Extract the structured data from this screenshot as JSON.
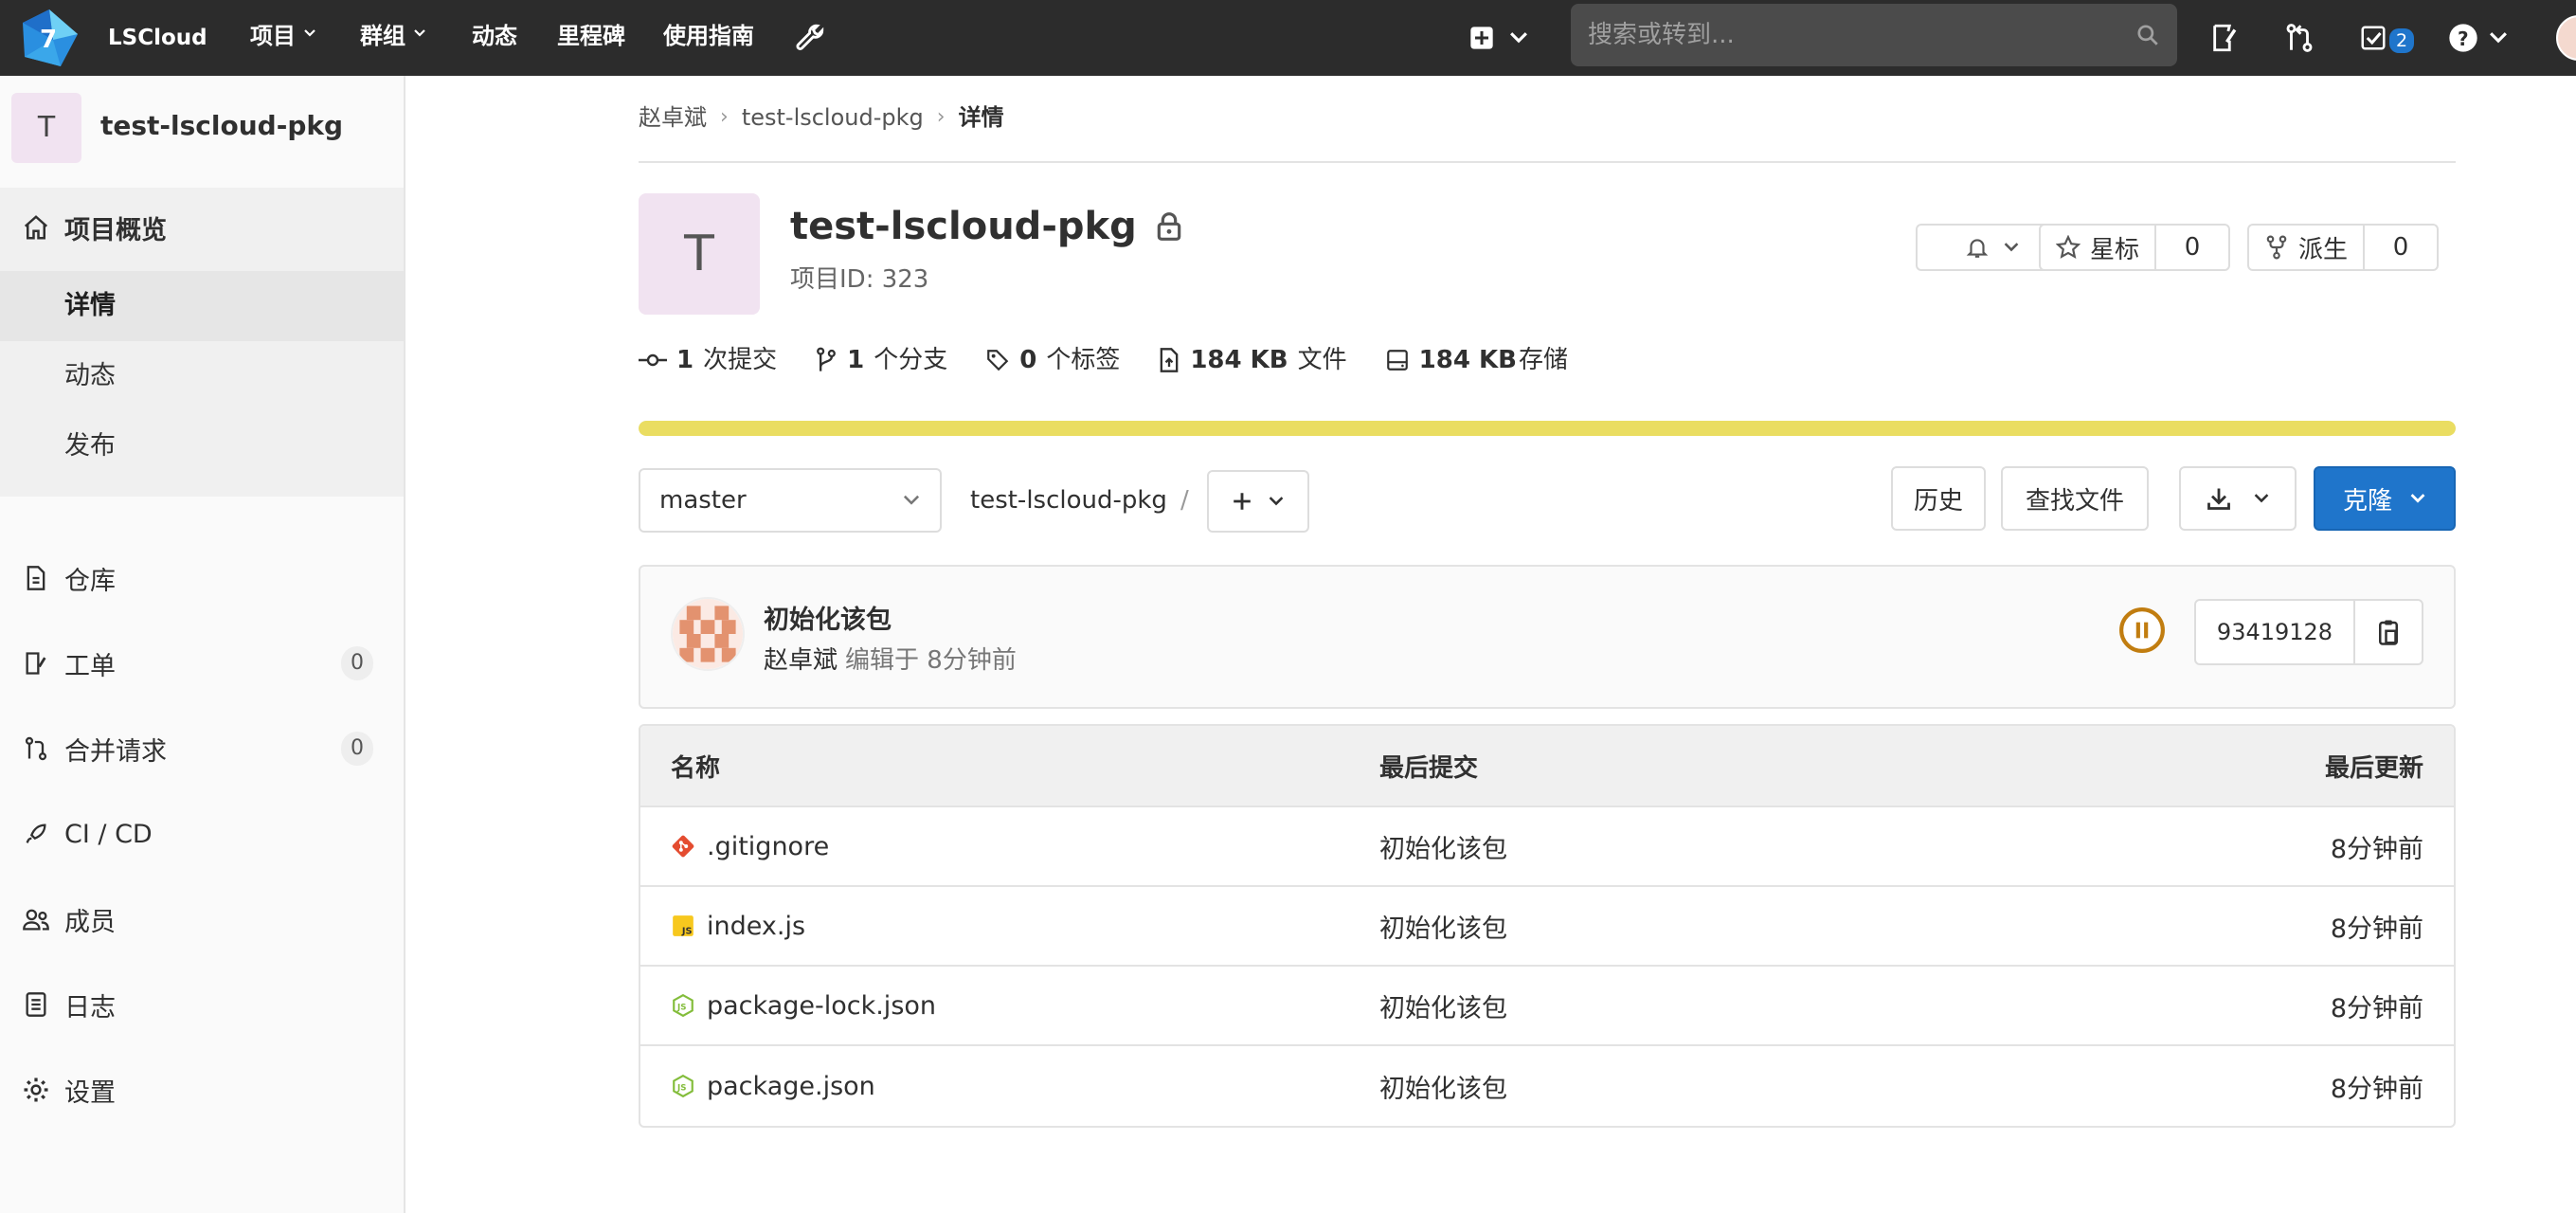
{
  "nav": {
    "brand": "LSCloud",
    "items": [
      "项目",
      "群组",
      "动态",
      "里程碑",
      "使用指南"
    ],
    "search_placeholder": "搜索或转到...",
    "todo_count": "2",
    "colors": {
      "bar": "#2c2c2c",
      "badge": "#1f75cb"
    }
  },
  "sidebar": {
    "avatar_letter": "T",
    "project_title": "test-lscloud-pkg",
    "overview": "项目概览",
    "sub_items": [
      "详情",
      "动态",
      "发布"
    ],
    "items": [
      {
        "label": "仓库",
        "icon": "file-icon"
      },
      {
        "label": "工单",
        "icon": "issues-icon",
        "count": "0"
      },
      {
        "label": "合并请求",
        "icon": "merge-request-icon",
        "count": "0"
      },
      {
        "label": "CI / CD",
        "icon": "rocket-icon"
      },
      {
        "label": "成员",
        "icon": "users-icon"
      },
      {
        "label": "日志",
        "icon": "log-icon"
      },
      {
        "label": "设置",
        "icon": "gear-icon"
      }
    ]
  },
  "breadcrumb": [
    "赵卓斌",
    "test-lscloud-pkg",
    "详情"
  ],
  "project": {
    "avatar_letter": "T",
    "name": "test-lscloud-pkg",
    "id_label": "项目ID: 323",
    "star_label": "星标",
    "star_count": "0",
    "fork_label": "派生",
    "fork_count": "0"
  },
  "stats": [
    {
      "value": "1",
      "label": "次提交"
    },
    {
      "value": "1",
      "label": "个分支"
    },
    {
      "value": "0",
      "label": "个标签"
    },
    {
      "value": "184 KB",
      "label": "文件"
    },
    {
      "value": "184 KB",
      "label": "存储"
    }
  ],
  "storage_progress_percent": 100,
  "toolbar": {
    "branch": "master",
    "path": "test-lscloud-pkg",
    "path_sep": "/",
    "history": "历史",
    "find_file": "查找文件",
    "clone": "克隆"
  },
  "commit": {
    "title": "初始化该包",
    "author": "赵卓斌",
    "meta": "编辑于 8分钟前",
    "sha": "93419128",
    "status_color": "#c17d10"
  },
  "files": {
    "headers": [
      "名称",
      "最后提交",
      "最后更新"
    ],
    "rows": [
      {
        "name": ".gitignore",
        "icon": "git-icon",
        "commit": "初始化该包",
        "updated": "8分钟前"
      },
      {
        "name": "index.js",
        "icon": "js-icon",
        "commit": "初始化该包",
        "updated": "8分钟前"
      },
      {
        "name": "package-lock.json",
        "icon": "nodejs-icon",
        "commit": "初始化该包",
        "updated": "8分钟前"
      },
      {
        "name": "package.json",
        "icon": "nodejs-icon",
        "commit": "初始化该包",
        "updated": "8分钟前"
      }
    ]
  },
  "accent": "#1f75cb"
}
